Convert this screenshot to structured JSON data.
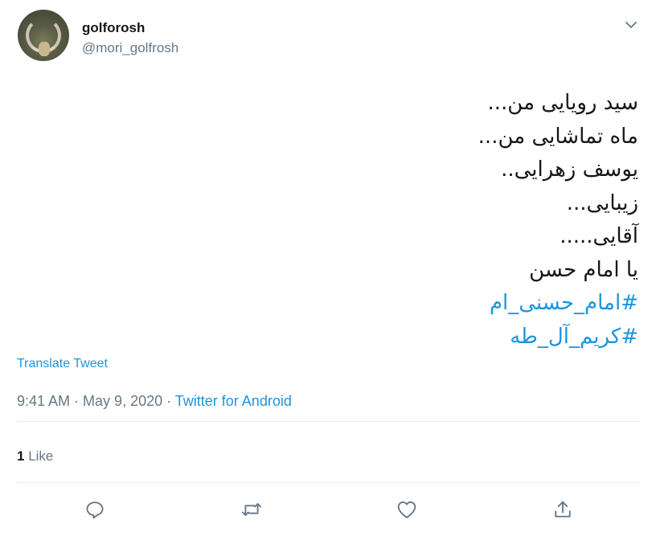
{
  "author": {
    "display_name": "golforosh",
    "handle": "@mori_golfrosh",
    "avatar_icon": "avatar-photo"
  },
  "tweet": {
    "lines": [
      "سید رویایی من...",
      "ماه تماشایی من...",
      "یوسف زهرایی..",
      "زیبایی...",
      "آقایی.....",
      "یا امام حسن"
    ],
    "hashtags": [
      "#امام_حسنی_ام",
      "#کریم_آل_طه"
    ]
  },
  "translate_label": "Translate Tweet",
  "meta": {
    "time": "9:41 AM",
    "separator": " · ",
    "date": "May 9, 2020",
    "separator2": " · ",
    "source": "Twitter for Android"
  },
  "stats": {
    "likes_count": "1",
    "likes_label": "Like"
  },
  "actions": [
    {
      "name": "reply",
      "icon": "reply-icon"
    },
    {
      "name": "retweet",
      "icon": "retweet-icon"
    },
    {
      "name": "like",
      "icon": "heart-icon"
    },
    {
      "name": "share",
      "icon": "share-icon"
    }
  ],
  "colors": {
    "link": "#1b95e0",
    "secondary_text": "#657786",
    "primary_text": "#14171a",
    "divider": "#e6ecf0"
  }
}
